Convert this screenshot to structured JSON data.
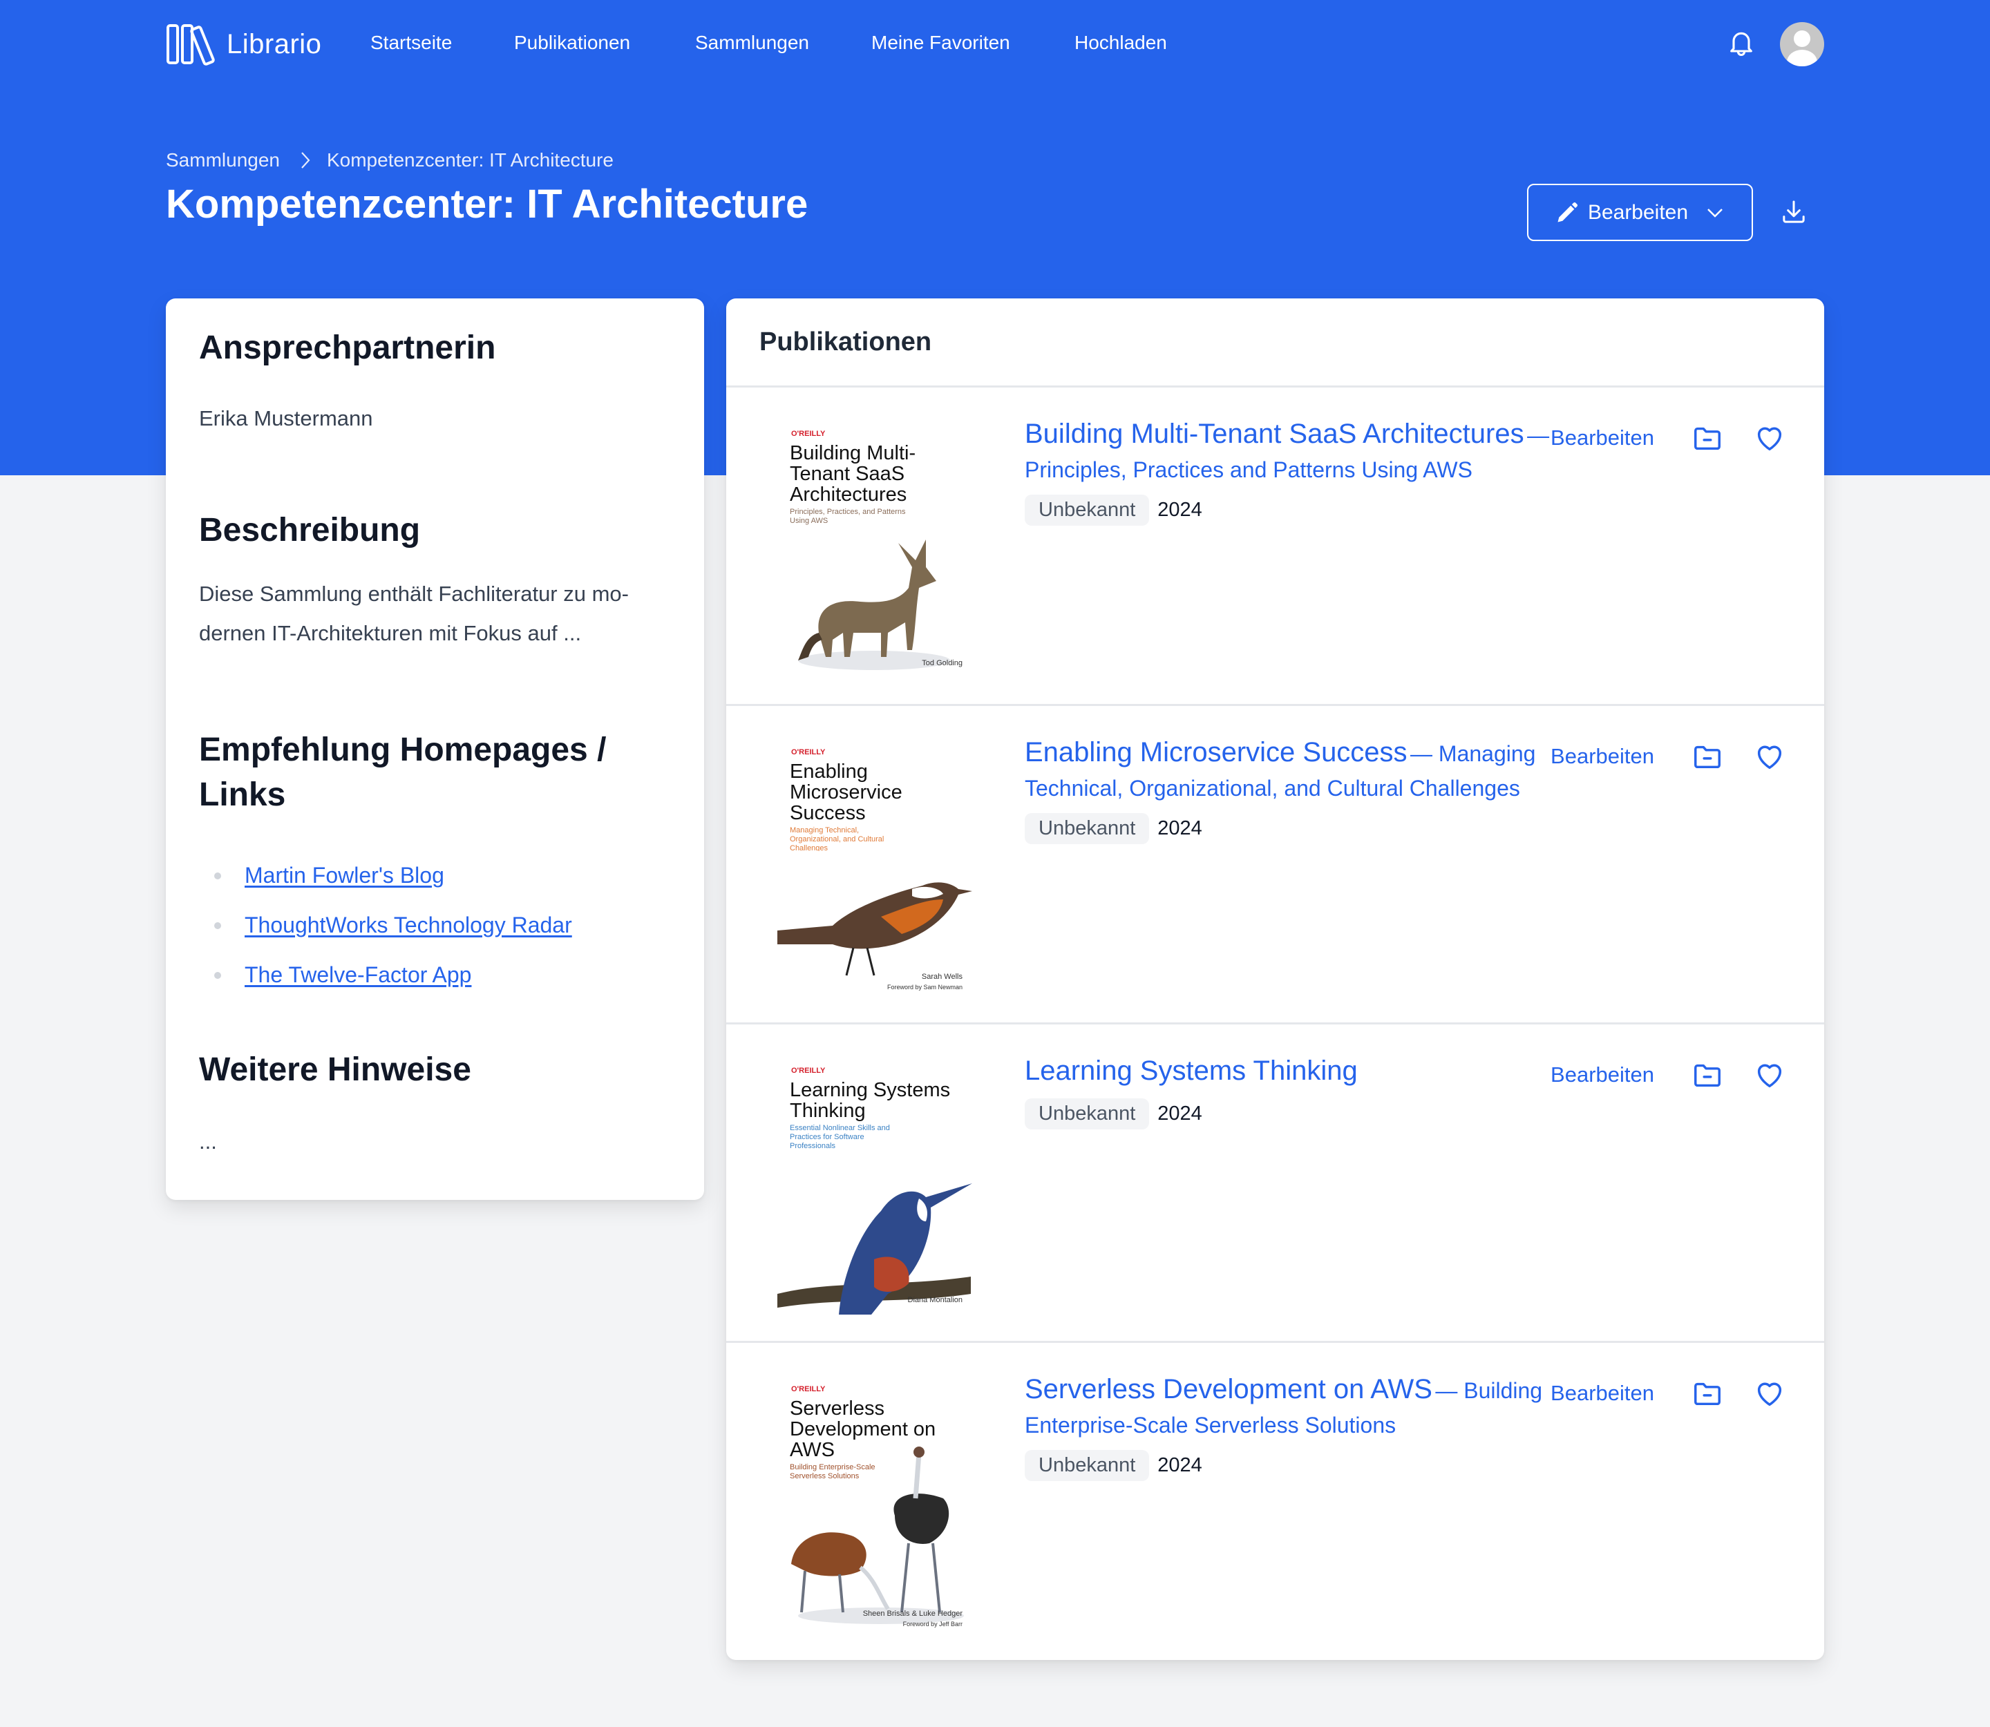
{
  "app": {
    "name": "Librario",
    "nav": [
      {
        "label": "Startseite"
      },
      {
        "label": "Publikationen"
      },
      {
        "label": "Sammlungen"
      },
      {
        "label": "Meine Favoriten"
      },
      {
        "label": "Hochladen"
      }
    ],
    "icons": {
      "notifications": "bell-icon",
      "user": "avatar-icon",
      "logo": "books-icon"
    }
  },
  "colors": {
    "brand": "#2563eb",
    "background": "#f3f4f6",
    "link": "#2563eb"
  },
  "breadcrumb": [
    {
      "label": "Sammlungen"
    },
    {
      "label": "Kompetenzcenter: IT Architecture"
    }
  ],
  "page": {
    "title": "Kompetenzcenter: IT Architecture",
    "edit_label": "Bearbeiten",
    "edit_icon": "pencil-icon",
    "download_icon": "download-icon"
  },
  "sidebar": {
    "contact_heading": "Ansprechpartnerin",
    "contact_name": "Erika Mustermann",
    "description_heading": "Beschreibung",
    "description_text": "Diese Sammlung enthält Fachliteratur zu mo­dernen IT-Architekturen mit Fokus auf ...",
    "links_heading": "Empfehlung Homepages / Links",
    "links": [
      {
        "label": "Martin Fowler's Blog"
      },
      {
        "label": "ThoughtWorks Technology Radar"
      },
      {
        "label": "The Twelve-Factor App"
      }
    ],
    "notes_heading": "Weitere Hinweise",
    "notes_text": "..."
  },
  "publications": {
    "heading": "Publikationen",
    "action_edit_label": "Bearbeiten",
    "items": [
      {
        "title": "Building Multi-Tenant SaaS Architectures",
        "subtitle": "— Principles, Practices and Patterns Using AWS",
        "badge": "Unbekannt",
        "year": "2024",
        "cover": {
          "publisher": "O'REILLY",
          "title": "Building Multi-Tenant SaaS Architectures",
          "subtitle": "Principles, Practices, and Patterns Using AWS",
          "author": "Tod Golding",
          "subtitle_color": "#8a6d5a",
          "animal": "fox"
        }
      },
      {
        "title": "Enabling Microservice Success",
        "subtitle": "— Managing Technical, Organizational, and Cultural Challenges",
        "badge": "Unbekannt",
        "year": "2024",
        "cover": {
          "publisher": "O'REILLY",
          "title": "Enabling Microservice Success",
          "subtitle": "Managing Technical, Organizational, and Cultural Challenges",
          "author": "Sarah Wells",
          "foreword": "Foreword by Sam Newman",
          "subtitle_color": "#e07b39",
          "animal": "bird"
        }
      },
      {
        "title": "Learning Systems Thinking",
        "subtitle": "",
        "badge": "Unbekannt",
        "year": "2024",
        "cover": {
          "publisher": "O'REILLY",
          "title": "Learning Systems Thinking",
          "subtitle": "Essential Nonlinear Skills and Practices for Software Professionals",
          "author": "Diana Montalion",
          "subtitle_color": "#3b82c4",
          "animal": "kingfisher"
        }
      },
      {
        "title": "Serverless Development on AWS",
        "subtitle": "— Building Enterprise-Scale Serverless Solutions",
        "badge": "Unbekannt",
        "year": "2024",
        "cover": {
          "publisher": "O'REILLY",
          "title": "Serverless Development on AWS",
          "subtitle": "Building Enterprise-Scale Serverless Solutions",
          "author": "Sheen Brisals & Luke Hedger",
          "foreword": "Foreword by Jeff Barr",
          "subtitle_color": "#a0522d",
          "animal": "ostrich"
        }
      }
    ]
  }
}
